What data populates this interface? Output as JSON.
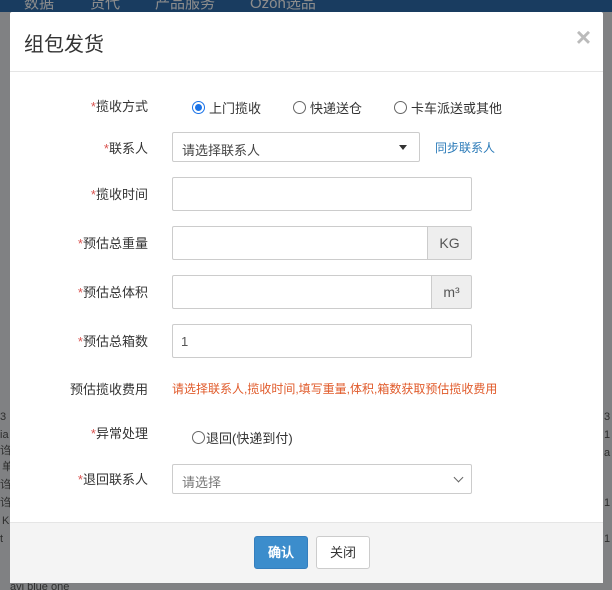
{
  "background": {
    "nav_items": [
      "数据",
      "货代",
      "产品服务",
      "Ozon选品"
    ],
    "left_fragments": [
      "3",
      "ia",
      "诌",
      "单",
      "诌",
      "诌",
      "K",
      "t"
    ],
    "right_fragments": [
      "3",
      "1",
      "a",
      "1",
      "1"
    ],
    "bottom_text": "avi blue one"
  },
  "modal": {
    "title": "组包发货",
    "close_icon": "×",
    "required_mark": "*",
    "pickup_method": {
      "label": "揽收方式",
      "options": [
        "上门揽收",
        "快递送仓",
        "卡车派送或其他"
      ],
      "selected": "上门揽收"
    },
    "contact": {
      "label": "联系人",
      "value": "请选择联系人",
      "sync_link": "同步联系人"
    },
    "pickup_time": {
      "label": "揽收时间",
      "value": ""
    },
    "total_weight": {
      "label": "预估总重量",
      "value": "",
      "unit": "KG"
    },
    "total_volume": {
      "label": "预估总体积",
      "value": "",
      "unit": "m³"
    },
    "total_boxes": {
      "label": "预估总箱数",
      "value": "1"
    },
    "pickup_fee": {
      "label": "预估揽收费用",
      "hint": "请选择联系人,揽收时间,填写重量,体积,箱数获取预估揽收费用"
    },
    "exception": {
      "label": "异常处理",
      "option": "退回(快递到付)"
    },
    "return_contact": {
      "label": "退回联系人",
      "placeholder": "请选择"
    },
    "buttons": {
      "confirm": "确认",
      "close": "关闭"
    }
  },
  "colors": {
    "primary": "#3c8dcc",
    "required": "#d9534f",
    "link": "#2a7ab8",
    "hint": "#e05a2a"
  }
}
